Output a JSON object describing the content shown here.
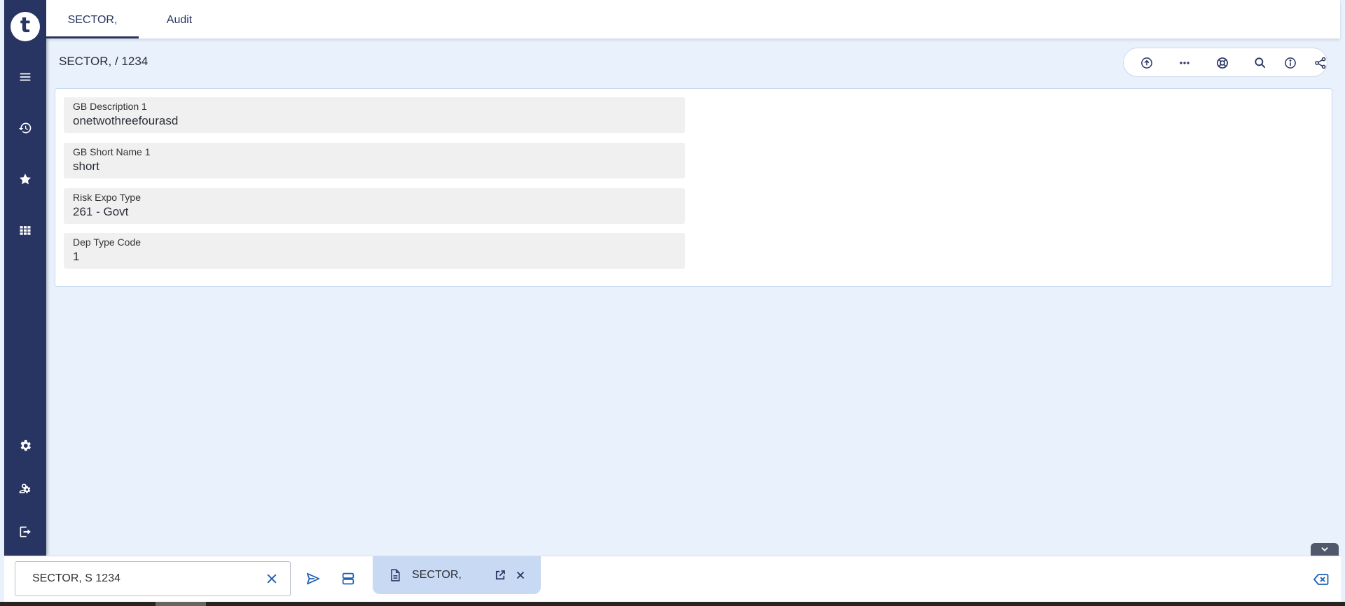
{
  "app": {
    "logo_letter": "t"
  },
  "tabs": [
    {
      "label": "SECTOR,",
      "active": true
    },
    {
      "label": "Audit",
      "active": false
    }
  ],
  "page": {
    "title": "SECTOR, / 1234"
  },
  "sidebar": {
    "items": [
      {
        "icon": "menu-icon"
      },
      {
        "icon": "history-icon"
      },
      {
        "icon": "star-icon"
      },
      {
        "icon": "apps-grid-icon"
      },
      {
        "icon": "gear-icon"
      },
      {
        "icon": "user-settings-icon"
      },
      {
        "icon": "logout-icon"
      }
    ]
  },
  "header_actions": [
    {
      "icon": "upload-icon"
    },
    {
      "icon": "more-icon"
    },
    {
      "icon": "lifebuoy-icon"
    },
    {
      "icon": "search-icon"
    },
    {
      "icon": "info-icon"
    },
    {
      "icon": "share-icon"
    }
  ],
  "form": {
    "fields": [
      {
        "label": "GB Description 1",
        "value": "onetwothreefourasd"
      },
      {
        "label": "GB Short Name 1",
        "value": "short"
      },
      {
        "label": "Risk Expo Type",
        "value": "261 - Govt"
      },
      {
        "label": "Dep Type Code",
        "value": "1"
      }
    ]
  },
  "bottom": {
    "command_value": "SECTOR, S 1234",
    "open_tab_title": "SECTOR,"
  },
  "colors": {
    "sidebar": "#283461",
    "accent": "#1e5fb5",
    "background": "#e9f1fc",
    "open_tab": "#c8d9f3"
  }
}
